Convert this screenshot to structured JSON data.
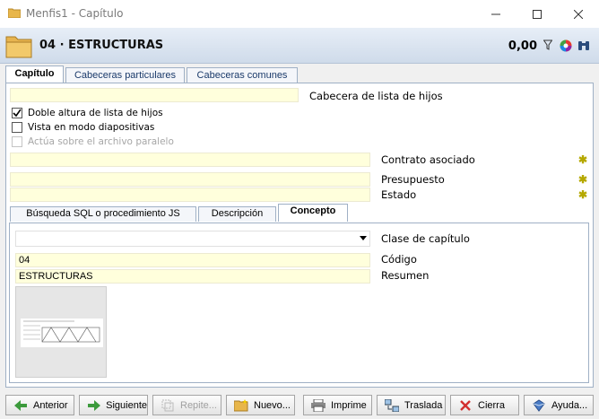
{
  "window": {
    "title": "Menfis1 - Capítulo"
  },
  "header": {
    "title": "04 · ESTRUCTURAS",
    "amount": "0,00"
  },
  "tabs": [
    {
      "label": "Capítulo"
    },
    {
      "label": "Cabeceras particulares"
    },
    {
      "label": "Cabeceras comunes"
    }
  ],
  "form": {
    "child_list_header": {
      "value": "",
      "label": "Cabecera de lista de hijos"
    },
    "checkboxes": [
      {
        "label": "Doble altura de lista de hijos",
        "checked": true,
        "disabled": false
      },
      {
        "label": "Vista en modo diapositivas",
        "checked": false,
        "disabled": false
      },
      {
        "label": "Actúa sobre el archivo paralelo",
        "checked": false,
        "disabled": true
      }
    ],
    "contrato": {
      "value": "",
      "label": "Contrato asociado"
    },
    "presupuesto": {
      "value": "",
      "label": "Presupuesto"
    },
    "estado": {
      "value": "",
      "label": "Estado"
    }
  },
  "subtabs": [
    {
      "label": "Búsqueda SQL o procedimiento JS"
    },
    {
      "label": "Descripción"
    },
    {
      "label": "Concepto"
    }
  ],
  "concepto": {
    "clase": {
      "value": "",
      "label": "Clase de capítulo"
    },
    "codigo": {
      "value": "04",
      "label": "Código"
    },
    "resumen": {
      "value": "ESTRUCTURAS",
      "label": "Resumen"
    }
  },
  "buttons": [
    {
      "label": "Anterior",
      "icon": "arrow-left-icon"
    },
    {
      "label": "Siguiente",
      "icon": "arrow-right-icon"
    },
    {
      "label": "Repite...",
      "icon": "repeat-icon"
    },
    {
      "label": "Nuevo...",
      "icon": "new-folder-icon"
    },
    {
      "label": "Imprime",
      "icon": "printer-icon"
    },
    {
      "label": "Traslada",
      "icon": "transfer-icon"
    },
    {
      "label": "Cierra",
      "icon": "close-x-icon"
    },
    {
      "label": "Ayuda...",
      "icon": "help-icon"
    }
  ],
  "colors": {
    "field_bg": "#ffffdc",
    "header_bg": "#cfdbea",
    "accent_star": "#b5a800"
  }
}
